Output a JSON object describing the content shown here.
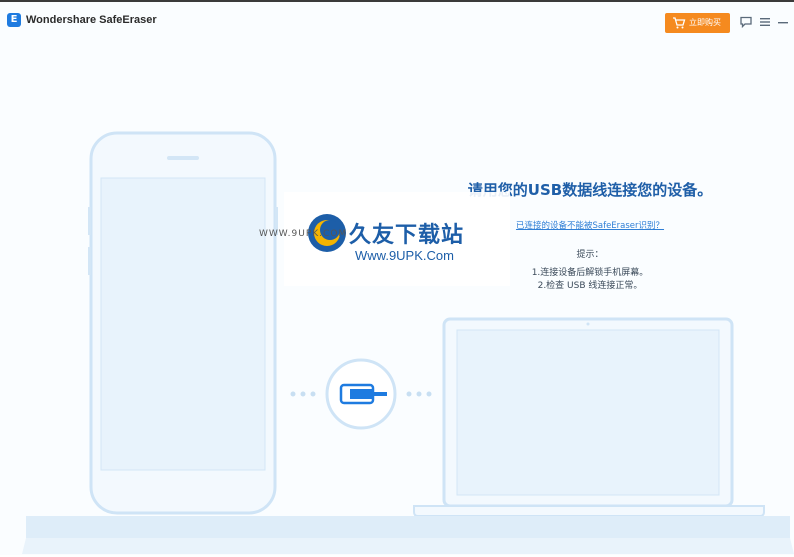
{
  "app": {
    "title": "Wondershare SafeEraser",
    "logo_letter": "E",
    "buy_label": "立即购买"
  },
  "toolbar": {
    "icons": [
      "feedback-icon",
      "menu-icon",
      "minimize-icon"
    ]
  },
  "main": {
    "title": "请用您的USB数据线连接您的设备。",
    "help_link": "已连接的设备不能被SafeEraser识别？",
    "tips_heading": "提示：",
    "tips": [
      "1.连接设备后解锁手机屏幕。",
      "2.检查 USB 线连接正常。"
    ]
  },
  "watermark": {
    "brand": "久友下载站",
    "url": "Www.9UPK.Com",
    "small": "WWW.9UPK.COM"
  },
  "colors": {
    "accent": "#f58a1f",
    "title_blue": "#1f5fa8",
    "link_blue": "#2f7fd6",
    "device_outline": "#cfe4f6",
    "device_fill": "#e8f3fc"
  }
}
